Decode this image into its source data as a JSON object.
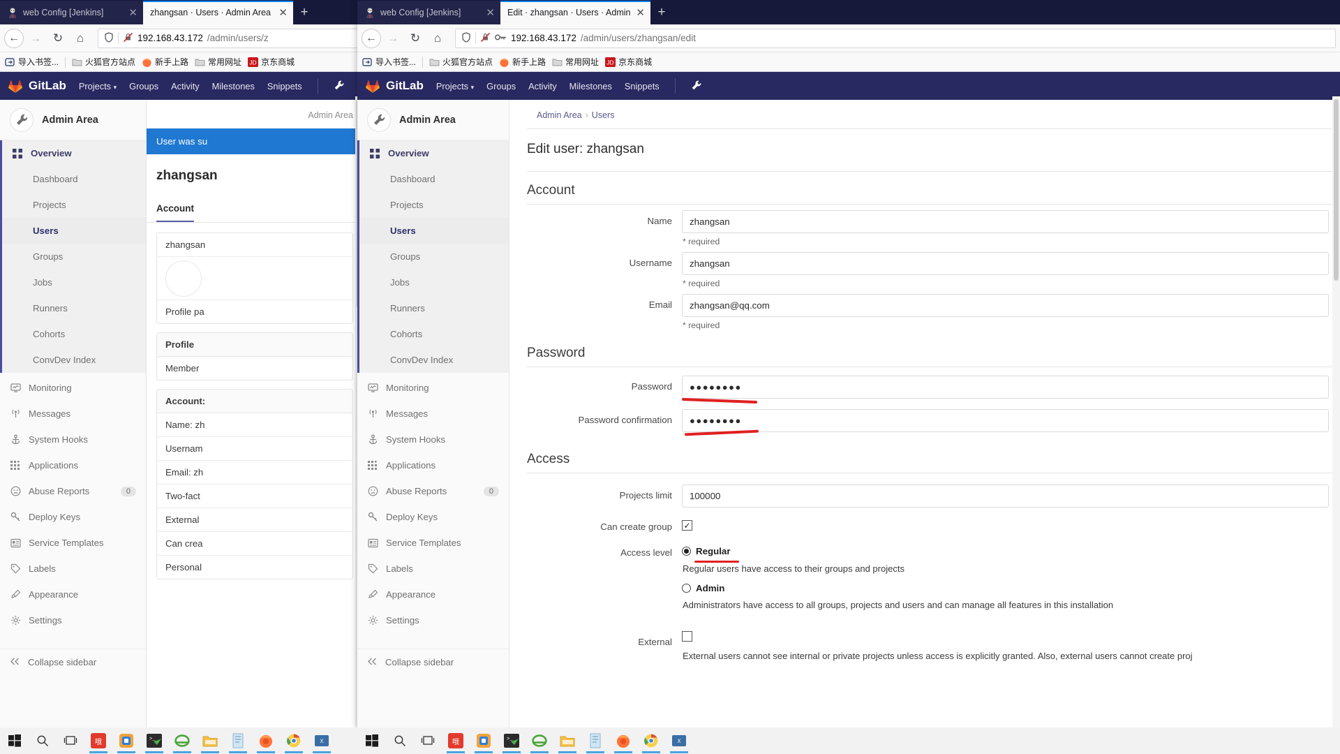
{
  "windows": {
    "left": {
      "tabs": [
        {
          "label": "web Config [Jenkins]",
          "active": false,
          "favicon": "jenkins-icon",
          "close": "✕"
        },
        {
          "label": "zhangsan · Users · Admin Area · G",
          "active": true,
          "favicon": "gitlab-icon",
          "close": "✕"
        }
      ],
      "newtab_label": "+",
      "nav": {
        "back": "←",
        "forward": "→",
        "reload": "↻",
        "home": "⌂",
        "url_host": "192.168.43.172",
        "url_path": "/admin/users/z"
      }
    },
    "right": {
      "tabs": [
        {
          "label": "web Config [Jenkins]",
          "active": false,
          "favicon": "jenkins-icon",
          "close": "✕"
        },
        {
          "label": "Edit · zhangsan · Users · Admin A",
          "active": true,
          "favicon": "",
          "close": "✕"
        }
      ],
      "newtab_label": "+",
      "nav": {
        "back": "←",
        "forward": "→",
        "reload": "↻",
        "home": "⌂",
        "url_host": "192.168.43.172",
        "url_path": "/admin/users/zhangsan/edit"
      }
    }
  },
  "bookmarks": [
    {
      "label": "导入书签...",
      "icon": "import-bookmarks-icon"
    },
    {
      "label": "火狐官方站点",
      "icon": "folder-icon"
    },
    {
      "label": "新手上路",
      "icon": "firefox-icon"
    },
    {
      "label": "常用网址",
      "icon": "folder-icon"
    },
    {
      "label": "京东商城",
      "icon": "jd-icon"
    }
  ],
  "gitlab": {
    "brand": "GitLab",
    "topnav": [
      "Projects",
      "Groups",
      "Activity",
      "Milestones",
      "Snippets"
    ],
    "projects_caret": "⌵",
    "wrench_icon": "wrench-icon",
    "admin_area": "Admin Area",
    "sidebar": {
      "overview": {
        "label": "Overview",
        "icon": "grid-icon"
      },
      "sub": [
        "Dashboard",
        "Projects",
        "Users",
        "Groups",
        "Jobs",
        "Runners",
        "Cohorts",
        "ConvDev Index"
      ],
      "current_sub": "Users",
      "items": [
        {
          "label": "Monitoring",
          "icon": "monitor-icon",
          "badge": ""
        },
        {
          "label": "Messages",
          "icon": "broadcast-icon",
          "badge": ""
        },
        {
          "label": "System Hooks",
          "icon": "anchor-icon",
          "badge": ""
        },
        {
          "label": "Applications",
          "icon": "apps-icon",
          "badge": ""
        },
        {
          "label": "Abuse Reports",
          "icon": "frown-icon",
          "badge": "0"
        },
        {
          "label": "Deploy Keys",
          "icon": "key-icon",
          "badge": ""
        },
        {
          "label": "Service Templates",
          "icon": "template-icon",
          "badge": ""
        },
        {
          "label": "Labels",
          "icon": "label-icon",
          "badge": ""
        },
        {
          "label": "Appearance",
          "icon": "paintbrush-icon",
          "badge": ""
        },
        {
          "label": "Settings",
          "icon": "gear-icon",
          "badge": ""
        }
      ],
      "collapse": {
        "label": "Collapse sidebar",
        "icon": "chevron-double-left-icon"
      }
    }
  },
  "left_page": {
    "breadcrumb_tail": "Admin Area",
    "flash": "User was su",
    "user_title": "zhangsan",
    "tab_account": "Account",
    "card1": [
      {
        "text": "zhangsan"
      },
      {
        "text": ""
      },
      {
        "text": "Profile pa"
      }
    ],
    "card2_header": "Profile",
    "card2_rows": [
      "Member"
    ],
    "card3_header": "Account:",
    "card3_rows": [
      "Name: zh",
      "Usernam",
      "Email: zh",
      "Two-fact",
      "External",
      "Can crea",
      "Personal"
    ]
  },
  "edit_page": {
    "breadcrumb": {
      "root": "Admin Area",
      "sep": "›",
      "leaf": "Users"
    },
    "title": "Edit user: zhangsan",
    "sections": [
      {
        "heading": "Account",
        "fields": [
          {
            "label": "Name",
            "value": "zhangsan",
            "hint": "* required",
            "type": "text"
          },
          {
            "label": "Username",
            "value": "zhangsan",
            "hint": "* required",
            "type": "text"
          },
          {
            "label": "Email",
            "value": "zhangsan@qq.com",
            "hint": "* required",
            "type": "text"
          }
        ]
      },
      {
        "heading": "Password",
        "fields": [
          {
            "label": "Password",
            "value": "●●●●●●●●",
            "hint": "",
            "type": "password"
          },
          {
            "label": "Password confirmation",
            "value": "●●●●●●●●",
            "hint": "",
            "type": "password"
          }
        ]
      }
    ],
    "access": {
      "heading": "Access",
      "projects_limit_label": "Projects limit",
      "projects_limit_value": "100000",
      "can_create_group_label": "Can create group",
      "can_create_group_checked": "✓",
      "access_level_label": "Access level",
      "options": [
        {
          "label": "Regular",
          "selected": true,
          "desc": "Regular users have access to their groups and projects"
        },
        {
          "label": "Admin",
          "selected": false,
          "desc": "Administrators have access to all groups, projects and users and can manage all features in this installation"
        }
      ],
      "external_label": "External",
      "external_checked": false,
      "external_desc": "External users cannot see internal or private projects unless access is explicitly granted. Also, external users cannot create proj"
    }
  },
  "taskbar": {
    "icons": [
      "windows-start-icon",
      "search-icon",
      "task-view-icon",
      "wps-icon",
      "vmware-icon",
      "editplus-icon",
      "ie-icon",
      "file-explorer-icon",
      "notepad-icon",
      "firefox-icon",
      "chrome-icon",
      "xshell-icon"
    ]
  },
  "colors": {
    "gitlab_purple": "#292961",
    "accent_blue": "#0a84ff",
    "flash_blue": "#1f78d1",
    "annotation_red": "#e02020"
  }
}
